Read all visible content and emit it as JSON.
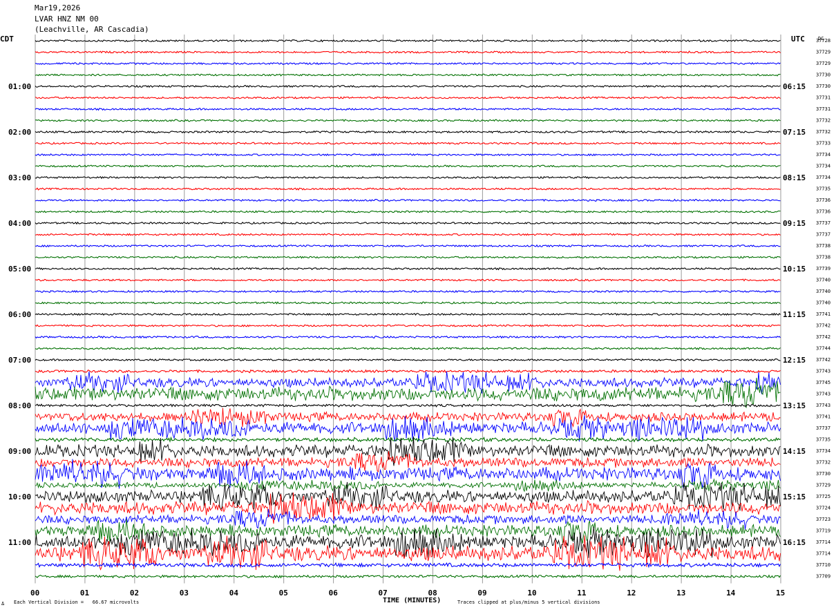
{
  "header": {
    "date": "Mar19,2026",
    "station": "LVAR HNZ NM 00",
    "location": "(Leachville, AR Cascadia)"
  },
  "left_axis_label": "CDT",
  "right_axis_label": "UTC",
  "dc_label": "DC",
  "footer": {
    "corner_glyph": "Δ",
    "scale_note": "Each Vertical Division =   66.67 microvolts",
    "time_label": "TIME (MINUTES)",
    "clip_note": "Traces clipped at plus/minus 5 vertical divisions"
  },
  "chart_data": {
    "type": "line",
    "description_free": true,
    "x_ticks": [
      "00",
      "01",
      "02",
      "03",
      "04",
      "05",
      "06",
      "07",
      "08",
      "09",
      "10",
      "11",
      "12",
      "13",
      "14",
      "15"
    ],
    "xlim": [
      0,
      15
    ],
    "left_hour_labels": [
      "01:00",
      "02:00",
      "03:00",
      "04:00",
      "05:00",
      "06:00",
      "07:00",
      "08:00",
      "09:00",
      "10:00",
      "11:00"
    ],
    "right_hour_labels": [
      "06:15",
      "07:15",
      "08:15",
      "09:15",
      "10:15",
      "11:15",
      "12:15",
      "13:15",
      "14:15",
      "15:15",
      "16:15"
    ],
    "trace_colors": [
      "#000000",
      "#ff0000",
      "#0000ff",
      "#007000"
    ],
    "dc_offsets": [
      "37728",
      "37729",
      "37729",
      "37730",
      "37730",
      "37731",
      "37731",
      "37732",
      "37732",
      "37733",
      "37734",
      "37734",
      "37734",
      "37735",
      "37736",
      "37736",
      "37737",
      "37737",
      "37738",
      "37738",
      "37739",
      "37740",
      "37740",
      "37740",
      "37741",
      "37742",
      "37742",
      "37744",
      "37742",
      "37743",
      "37745",
      "37743",
      "37743",
      "37741",
      "37737",
      "37735",
      "37734",
      "37732",
      "37730",
      "37729",
      "37725",
      "37724",
      "37723",
      "37719",
      "37714",
      "37714",
      "37710",
      "37709"
    ],
    "trace_activity": [
      0.05,
      0.05,
      0.05,
      0.05,
      0.05,
      0.05,
      0.05,
      0.05,
      0.06,
      0.05,
      0.05,
      0.05,
      0.05,
      0.05,
      0.05,
      0.05,
      0.05,
      0.05,
      0.05,
      0.05,
      0.05,
      0.05,
      0.05,
      0.05,
      0.05,
      0.05,
      0.06,
      0.05,
      0.05,
      0.1,
      0.6,
      0.9,
      0.1,
      0.55,
      0.75,
      0.2,
      0.8,
      0.6,
      0.85,
      0.3,
      0.8,
      0.85,
      0.55,
      0.75,
      0.9,
      1.0,
      0.2,
      0.1
    ]
  }
}
